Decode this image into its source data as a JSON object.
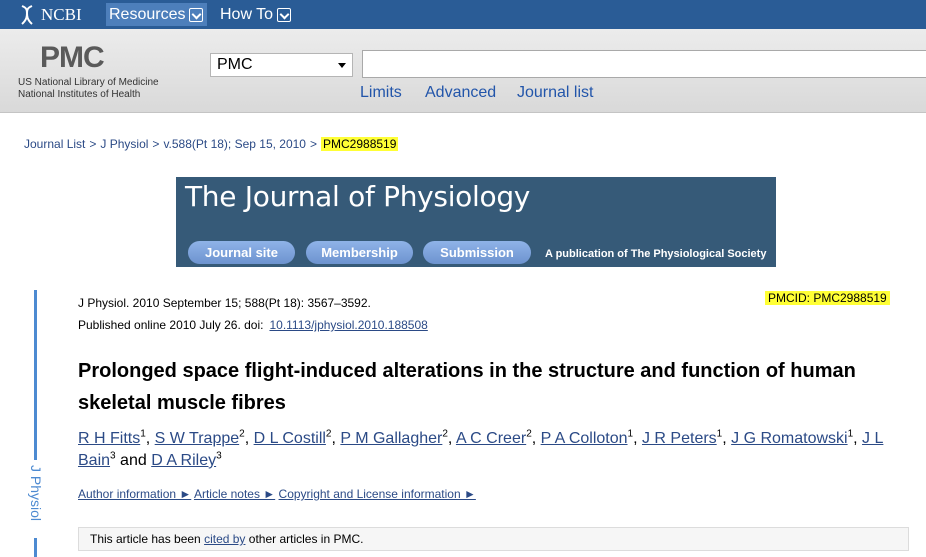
{
  "topbar": {
    "logo": "NCBI",
    "menu": [
      {
        "label": "Resources"
      },
      {
        "label": "How To"
      }
    ]
  },
  "header": {
    "pmc_logo": "PMC",
    "nlm_line1": "US National Library of Medicine",
    "nlm_line2": "National Institutes of Health",
    "db_select_value": "PMC",
    "search_value": "",
    "links": [
      "Limits",
      "Advanced",
      "Journal list"
    ]
  },
  "breadcrumb": [
    "Journal List",
    "J Physiol",
    "v.588(Pt 18); Sep 15, 2010",
    "PMC2988519"
  ],
  "banner": {
    "title": "The Journal of Physiology",
    "buttons": [
      "Journal site",
      "Membership",
      "Submission"
    ],
    "publication": "A publication of The Physiological Society"
  },
  "sidebar_label": "J Physiol",
  "citation": {
    "line1": "J Physiol. 2010 September 15; 588(Pt 18): 3567–3592.",
    "line2_prefix": "Published online 2010 July 26. doi:",
    "doi": "10.1113/jphysiol.2010.188508",
    "pmcid": "PMCID: PMC2988519"
  },
  "article": {
    "title": "Prolonged space flight-induced alterations in the structure and function of human skeletal muscle fibres",
    "authors": [
      {
        "name": "R H Fitts",
        "sup": "1"
      },
      {
        "name": "S W Trappe",
        "sup": "2"
      },
      {
        "name": "D L Costill",
        "sup": "2"
      },
      {
        "name": "P M Gallagher",
        "sup": "2"
      },
      {
        "name": "A C Creer",
        "sup": "2"
      },
      {
        "name": "P A Colloton",
        "sup": "1"
      },
      {
        "name": "J R Peters",
        "sup": "1"
      },
      {
        "name": "J G Romatowski",
        "sup": "1"
      },
      {
        "name": "J L Bain",
        "sup": "3"
      },
      {
        "name": "D A Riley",
        "sup": "3"
      }
    ],
    "and_word": "and",
    "info_links": [
      "Author information ►",
      "Article notes ►",
      "Copyright and License information ►"
    ]
  },
  "cited": {
    "prefix": "This article has been",
    "link": "cited by",
    "suffix": "other articles in PMC."
  },
  "colors": {
    "ncbi_bar": "#2a5c96",
    "link": "#2b4a86",
    "highlight": "#ffff35",
    "banner": "#365a78"
  }
}
